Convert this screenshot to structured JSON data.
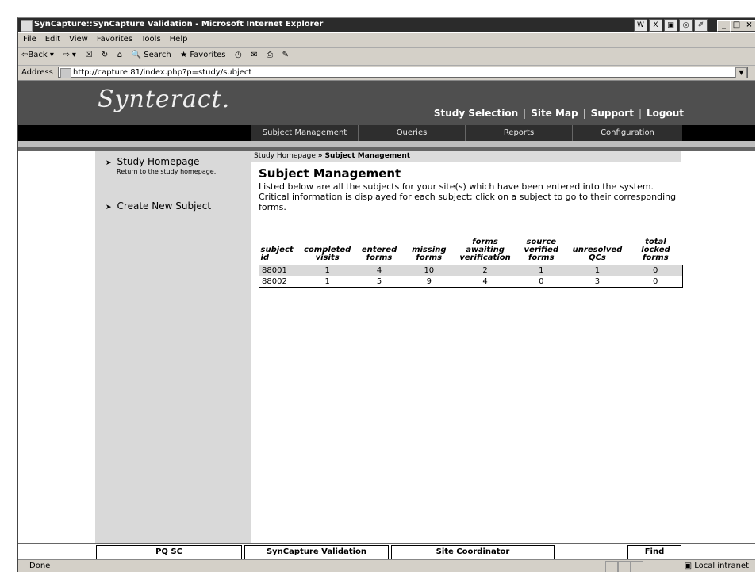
{
  "window": {
    "title": "SynCapture::SynCapture Validation - Microsoft Internet Explorer",
    "tray_icons": [
      "W",
      "X",
      "▣",
      "◎",
      "✐"
    ],
    "controls": [
      "_",
      "□",
      "×"
    ]
  },
  "menubar": [
    "File",
    "Edit",
    "View",
    "Favorites",
    "Tools",
    "Help"
  ],
  "toolbar": {
    "back": "⇦Back ▾",
    "forward": "⇨ ▾",
    "search": "Search",
    "favorites": "Favorites"
  },
  "address": {
    "label": "Address",
    "url": "http://capture:81/index.php?p=study/subject"
  },
  "header": {
    "logo": "Synteract.",
    "links": [
      "Study Selection",
      "Site Map",
      "Support",
      "Logout"
    ],
    "separator": "|"
  },
  "nav": {
    "tabs": [
      "Subject Management",
      "Queries",
      "Reports",
      "Configuration"
    ]
  },
  "breadcrumb": {
    "home": "Study Homepage",
    "sep": "»",
    "current": "Subject Management"
  },
  "sidebar": {
    "items": [
      {
        "label": "Study Homepage",
        "sub": "Return to the study homepage."
      },
      {
        "label": "Create New Subject",
        "sub": ""
      }
    ]
  },
  "main": {
    "title": "Subject Management",
    "description": "Listed below are all the subjects for your site(s) which have been entered into the system. Critical information is displayed for each subject; click on a subject to go to their corresponding forms."
  },
  "table": {
    "headers": [
      "subject id",
      "completed visits",
      "entered forms",
      "missing forms",
      "forms awaiting verification",
      "source verified forms",
      "unresolved QCs",
      "total locked forms"
    ],
    "rows": [
      [
        "88001",
        "1",
        "4",
        "10",
        "2",
        "1",
        "1",
        "0"
      ],
      [
        "88002",
        "1",
        "5",
        "9",
        "4",
        "0",
        "3",
        "0"
      ]
    ]
  },
  "footer": {
    "site": "PQ SC",
    "study": "SynCapture Validation",
    "role": "Site Coordinator",
    "find": "Find"
  },
  "status": {
    "text": "Done",
    "zone": "Local intranet"
  }
}
